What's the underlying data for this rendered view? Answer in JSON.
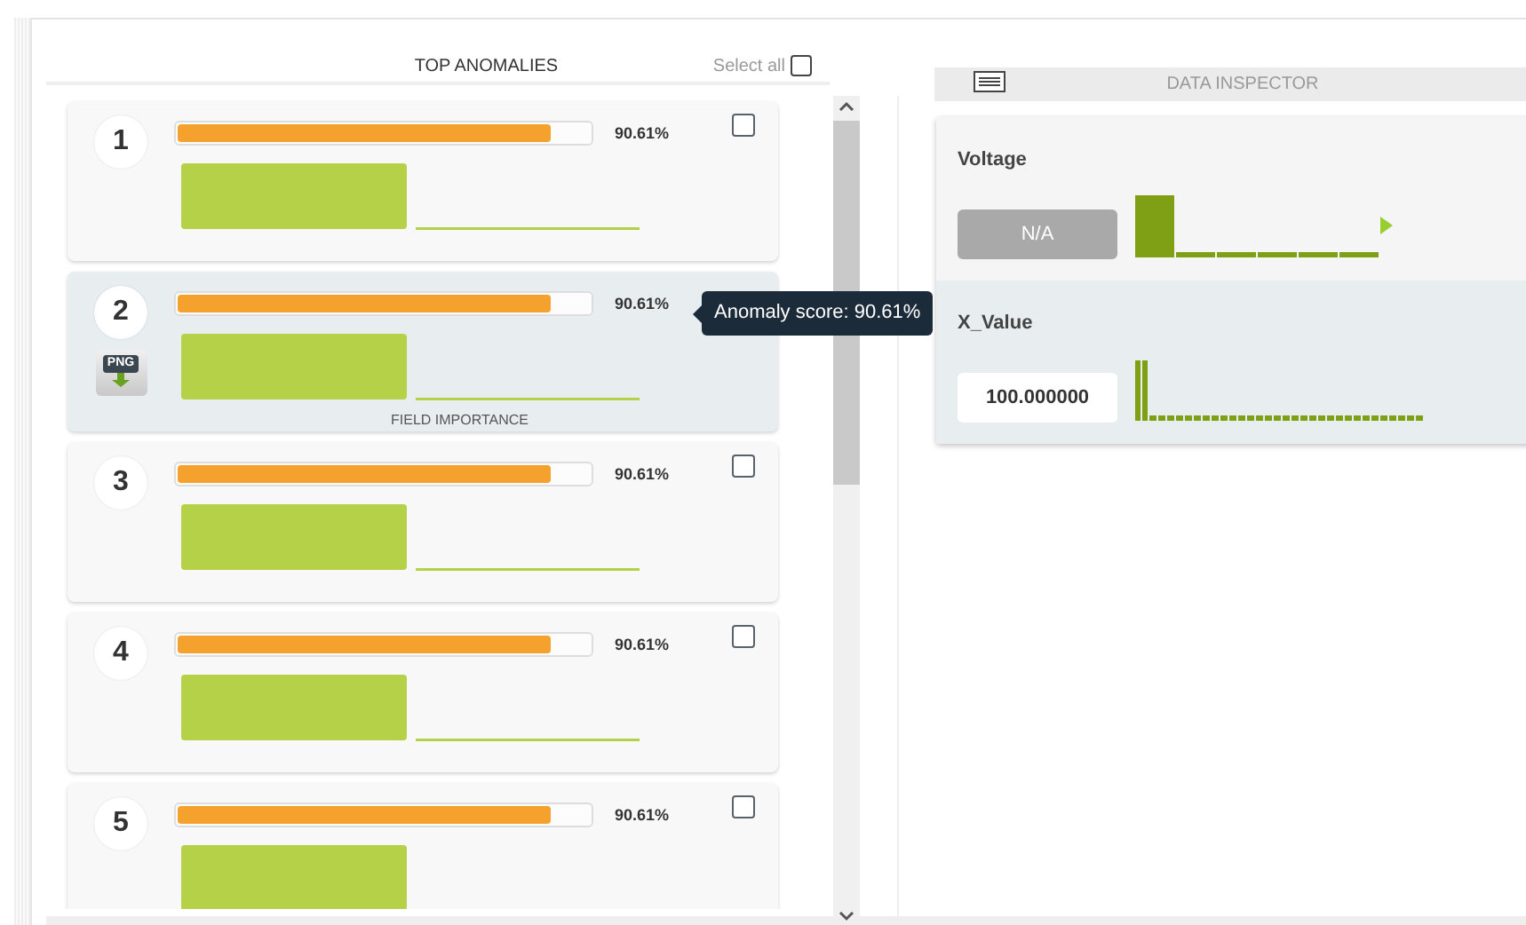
{
  "top_anomalies": {
    "title": "TOP ANOMALIES",
    "select_all": {
      "label": "Select all",
      "checked": false
    },
    "anomalies": [
      {
        "rank": "1",
        "score": "90.61%",
        "level": 0.906,
        "checked": false,
        "highlighted": false
      },
      {
        "rank": "2",
        "score": "90.61%",
        "level": 0.906,
        "highlighted": true,
        "export_label": "PNG",
        "field_importance_label": "FIELD IMPORTANCE",
        "tooltip": "Anomaly score: 90.61%"
      },
      {
        "rank": "3",
        "score": "90.61%",
        "level": 0.906,
        "checked": false,
        "highlighted": false
      },
      {
        "rank": "4",
        "score": "90.61%",
        "level": 0.906,
        "checked": false,
        "highlighted": false
      },
      {
        "rank": "5",
        "score": "90.61%",
        "level": 0.906,
        "checked": false,
        "highlighted": false
      }
    ]
  },
  "data_inspector": {
    "title": "DATA INSPECTOR",
    "fields": [
      {
        "name": "Voltage",
        "value": "N/A",
        "missing": true,
        "highlighted": false
      },
      {
        "name": "X_Value",
        "value": "100.000000",
        "missing": false,
        "highlighted": true
      }
    ]
  }
}
